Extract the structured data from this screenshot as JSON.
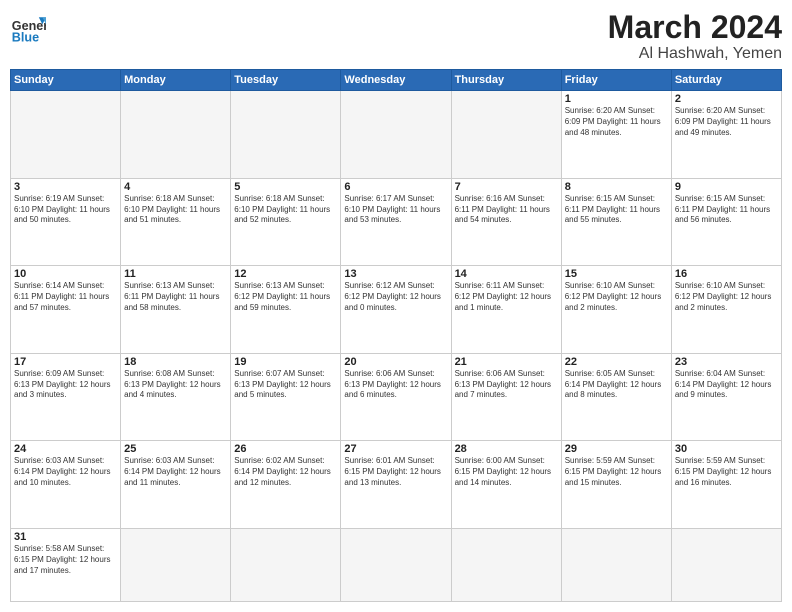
{
  "header": {
    "logo_general": "General",
    "logo_blue": "Blue",
    "title": "March 2024",
    "subtitle": "Al Hashwah, Yemen"
  },
  "weekdays": [
    "Sunday",
    "Monday",
    "Tuesday",
    "Wednesday",
    "Thursday",
    "Friday",
    "Saturday"
  ],
  "weeks": [
    [
      {
        "day": "",
        "info": ""
      },
      {
        "day": "",
        "info": ""
      },
      {
        "day": "",
        "info": ""
      },
      {
        "day": "",
        "info": ""
      },
      {
        "day": "",
        "info": ""
      },
      {
        "day": "1",
        "info": "Sunrise: 6:20 AM\nSunset: 6:09 PM\nDaylight: 11 hours\nand 48 minutes."
      },
      {
        "day": "2",
        "info": "Sunrise: 6:20 AM\nSunset: 6:09 PM\nDaylight: 11 hours\nand 49 minutes."
      }
    ],
    [
      {
        "day": "3",
        "info": "Sunrise: 6:19 AM\nSunset: 6:10 PM\nDaylight: 11 hours\nand 50 minutes."
      },
      {
        "day": "4",
        "info": "Sunrise: 6:18 AM\nSunset: 6:10 PM\nDaylight: 11 hours\nand 51 minutes."
      },
      {
        "day": "5",
        "info": "Sunrise: 6:18 AM\nSunset: 6:10 PM\nDaylight: 11 hours\nand 52 minutes."
      },
      {
        "day": "6",
        "info": "Sunrise: 6:17 AM\nSunset: 6:10 PM\nDaylight: 11 hours\nand 53 minutes."
      },
      {
        "day": "7",
        "info": "Sunrise: 6:16 AM\nSunset: 6:11 PM\nDaylight: 11 hours\nand 54 minutes."
      },
      {
        "day": "8",
        "info": "Sunrise: 6:15 AM\nSunset: 6:11 PM\nDaylight: 11 hours\nand 55 minutes."
      },
      {
        "day": "9",
        "info": "Sunrise: 6:15 AM\nSunset: 6:11 PM\nDaylight: 11 hours\nand 56 minutes."
      }
    ],
    [
      {
        "day": "10",
        "info": "Sunrise: 6:14 AM\nSunset: 6:11 PM\nDaylight: 11 hours\nand 57 minutes."
      },
      {
        "day": "11",
        "info": "Sunrise: 6:13 AM\nSunset: 6:11 PM\nDaylight: 11 hours\nand 58 minutes."
      },
      {
        "day": "12",
        "info": "Sunrise: 6:13 AM\nSunset: 6:12 PM\nDaylight: 11 hours\nand 59 minutes."
      },
      {
        "day": "13",
        "info": "Sunrise: 6:12 AM\nSunset: 6:12 PM\nDaylight: 12 hours\nand 0 minutes."
      },
      {
        "day": "14",
        "info": "Sunrise: 6:11 AM\nSunset: 6:12 PM\nDaylight: 12 hours\nand 1 minute."
      },
      {
        "day": "15",
        "info": "Sunrise: 6:10 AM\nSunset: 6:12 PM\nDaylight: 12 hours\nand 2 minutes."
      },
      {
        "day": "16",
        "info": "Sunrise: 6:10 AM\nSunset: 6:12 PM\nDaylight: 12 hours\nand 2 minutes."
      }
    ],
    [
      {
        "day": "17",
        "info": "Sunrise: 6:09 AM\nSunset: 6:13 PM\nDaylight: 12 hours\nand 3 minutes."
      },
      {
        "day": "18",
        "info": "Sunrise: 6:08 AM\nSunset: 6:13 PM\nDaylight: 12 hours\nand 4 minutes."
      },
      {
        "day": "19",
        "info": "Sunrise: 6:07 AM\nSunset: 6:13 PM\nDaylight: 12 hours\nand 5 minutes."
      },
      {
        "day": "20",
        "info": "Sunrise: 6:06 AM\nSunset: 6:13 PM\nDaylight: 12 hours\nand 6 minutes."
      },
      {
        "day": "21",
        "info": "Sunrise: 6:06 AM\nSunset: 6:13 PM\nDaylight: 12 hours\nand 7 minutes."
      },
      {
        "day": "22",
        "info": "Sunrise: 6:05 AM\nSunset: 6:14 PM\nDaylight: 12 hours\nand 8 minutes."
      },
      {
        "day": "23",
        "info": "Sunrise: 6:04 AM\nSunset: 6:14 PM\nDaylight: 12 hours\nand 9 minutes."
      }
    ],
    [
      {
        "day": "24",
        "info": "Sunrise: 6:03 AM\nSunset: 6:14 PM\nDaylight: 12 hours\nand 10 minutes."
      },
      {
        "day": "25",
        "info": "Sunrise: 6:03 AM\nSunset: 6:14 PM\nDaylight: 12 hours\nand 11 minutes."
      },
      {
        "day": "26",
        "info": "Sunrise: 6:02 AM\nSunset: 6:14 PM\nDaylight: 12 hours\nand 12 minutes."
      },
      {
        "day": "27",
        "info": "Sunrise: 6:01 AM\nSunset: 6:15 PM\nDaylight: 12 hours\nand 13 minutes."
      },
      {
        "day": "28",
        "info": "Sunrise: 6:00 AM\nSunset: 6:15 PM\nDaylight: 12 hours\nand 14 minutes."
      },
      {
        "day": "29",
        "info": "Sunrise: 5:59 AM\nSunset: 6:15 PM\nDaylight: 12 hours\nand 15 minutes."
      },
      {
        "day": "30",
        "info": "Sunrise: 5:59 AM\nSunset: 6:15 PM\nDaylight: 12 hours\nand 16 minutes."
      }
    ],
    [
      {
        "day": "31",
        "info": "Sunrise: 5:58 AM\nSunset: 6:15 PM\nDaylight: 12 hours\nand 17 minutes."
      },
      {
        "day": "",
        "info": ""
      },
      {
        "day": "",
        "info": ""
      },
      {
        "day": "",
        "info": ""
      },
      {
        "day": "",
        "info": ""
      },
      {
        "day": "",
        "info": ""
      },
      {
        "day": "",
        "info": ""
      }
    ]
  ]
}
